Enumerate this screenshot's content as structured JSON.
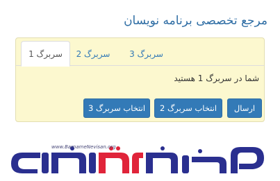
{
  "header": {
    "title": "مرجع تخصصی برنامه نویسان"
  },
  "tabs": [
    {
      "label": "سربرگ 1",
      "active": true
    },
    {
      "label": "سربرگ 2",
      "active": false
    },
    {
      "label": "سربرگ 3",
      "active": false
    }
  ],
  "content": {
    "status_text": "شما در سربرگ 1 هستید"
  },
  "buttons": {
    "send_label": "ارسال",
    "select_tab2_label": "انتخاب سربرگ 2",
    "select_tab3_label": "انتخاب سربرگ 3"
  },
  "logo": {
    "url_text": "www.BarnameNevisan.org",
    "wordmark": "برنامه نویسان",
    "colors": {
      "primary": "#2a2f8f",
      "accent": "#e0243a"
    }
  },
  "theme": {
    "link_color": "#337ab7",
    "panel_bg": "#fcf8cf",
    "button_bg": "#337ab7"
  }
}
